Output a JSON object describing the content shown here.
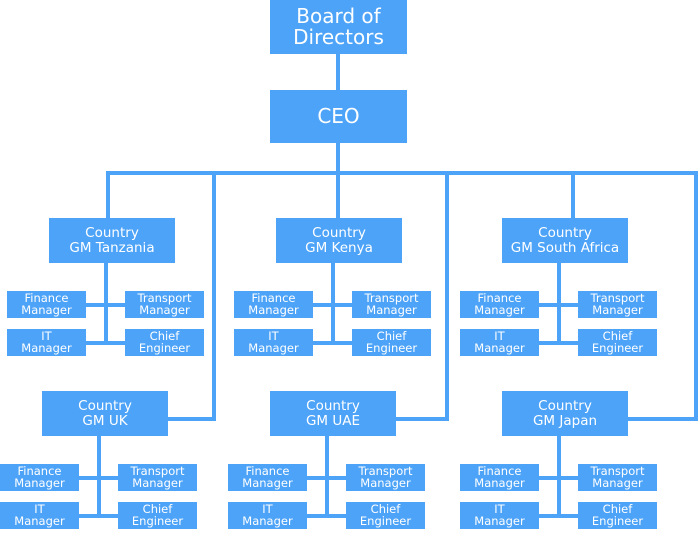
{
  "board": {
    "line1": "Board of",
    "line2": "Directors"
  },
  "ceo": {
    "label": "CEO"
  },
  "countries": [
    {
      "line1": "Country",
      "line2": "GM Tanzania"
    },
    {
      "line1": "Country",
      "line2": "GM Kenya"
    },
    {
      "line1": "Country",
      "line2": "GM South Africa"
    },
    {
      "line1": "Country",
      "line2": "GM UK"
    },
    {
      "line1": "Country",
      "line2": "GM UAE"
    },
    {
      "line1": "Country",
      "line2": "GM Japan"
    }
  ],
  "roles": [
    {
      "line1": "Finance",
      "line2": "Manager"
    },
    {
      "line1": "Transport",
      "line2": "Manager"
    },
    {
      "line1": "IT",
      "line2": "Manager"
    },
    {
      "line1": "Chief",
      "line2": "Engineer"
    }
  ],
  "colors": {
    "box": "#4da3f8",
    "text": "#ffffff"
  }
}
